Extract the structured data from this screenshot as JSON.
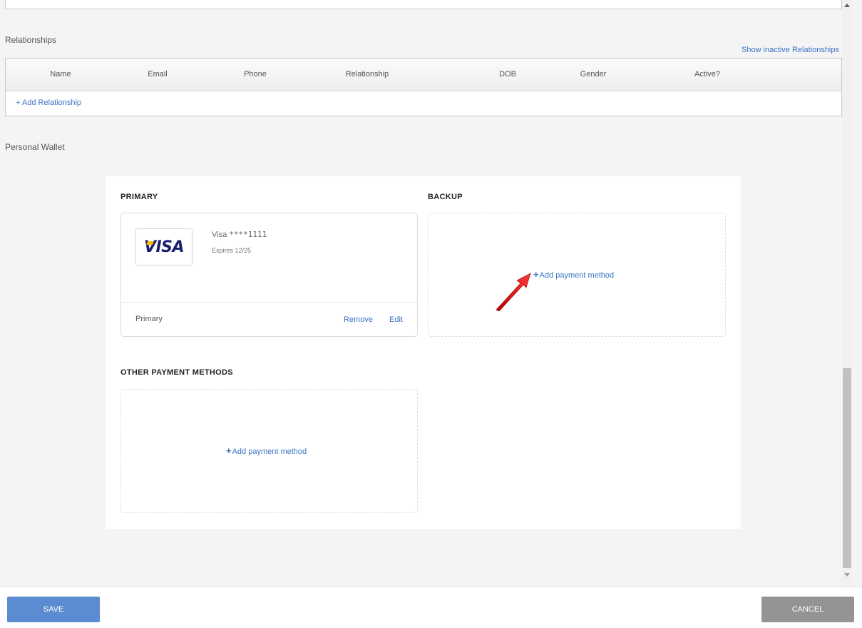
{
  "relationships": {
    "section_label": "Relationships",
    "show_inactive_link": "Show inactive Relationships",
    "columns": [
      "Name",
      "Email",
      "Phone",
      "Relationship",
      "DOB",
      "Gender",
      "Active?"
    ],
    "add_link": "+ Add Relationship"
  },
  "wallet": {
    "section_label": "Personal Wallet",
    "primary": {
      "heading": "PRIMARY",
      "card": {
        "logo_text": "VISA",
        "brand": "Visa",
        "masked_number": "****1111",
        "expires": "Expires 12/25",
        "status": "Primary",
        "remove_label": "Remove",
        "edit_label": "Edit"
      }
    },
    "backup": {
      "heading": "BACKUP",
      "add_label": "Add payment method"
    },
    "other": {
      "heading": "OTHER PAYMENT METHODS",
      "add_label": "Add payment method"
    }
  },
  "icons": {
    "plus": "plus-icon",
    "pointer": "red-arrow-annotation",
    "scroll_up": "scroll-up-arrow",
    "scroll_down": "scroll-down-arrow"
  },
  "colors": {
    "link": "#3b73c4",
    "save_button": "#5b8bd0",
    "cancel_button": "#949494",
    "annotation_arrow": "#e02020"
  },
  "footer": {
    "save_label": "SAVE",
    "cancel_label": "CANCEL"
  }
}
